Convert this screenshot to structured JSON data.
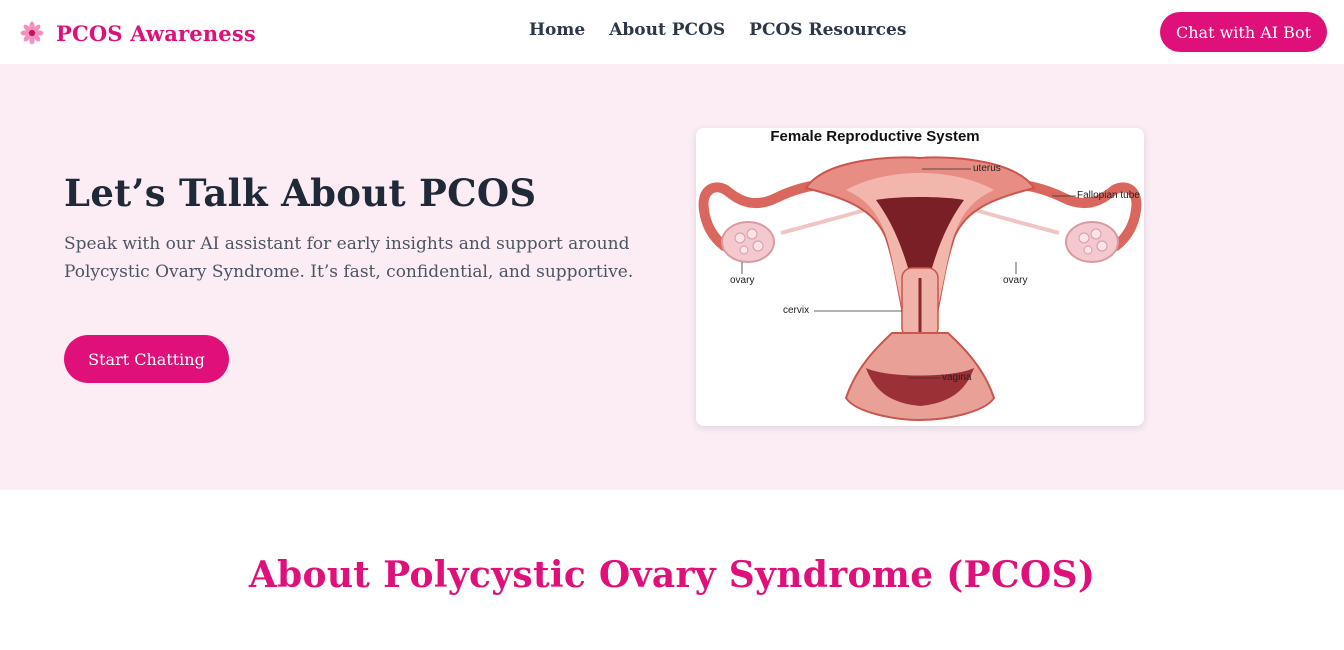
{
  "navbar": {
    "brand": "PCOS Awareness",
    "brand_icon": "flower-icon",
    "links": [
      "Home",
      "About PCOS",
      "PCOS Resources"
    ],
    "cta": "Chat with AI Bot"
  },
  "hero": {
    "title": "Let’s Talk About PCOS",
    "text": "Speak with our AI assistant for early insights and support around Polycystic Ovary Syndrome. It’s fast, confidential, and supportive.",
    "button": "Start Chatting",
    "figure": {
      "title": "Female Reproductive System",
      "labels": {
        "uterus": "uterus",
        "fallopian_tube": "Fallopian tube",
        "ovary_left": "ovary",
        "ovary_right": "ovary",
        "cervix": "cervix",
        "vagina": "vagina"
      }
    }
  },
  "about": {
    "title": "About Polycystic Ovary Syndrome (PCOS)"
  },
  "colors": {
    "accent": "#e0107a",
    "hero_bg": "#fcedf5",
    "text_dark": "#1f2937",
    "text_muted": "#4b5563"
  }
}
